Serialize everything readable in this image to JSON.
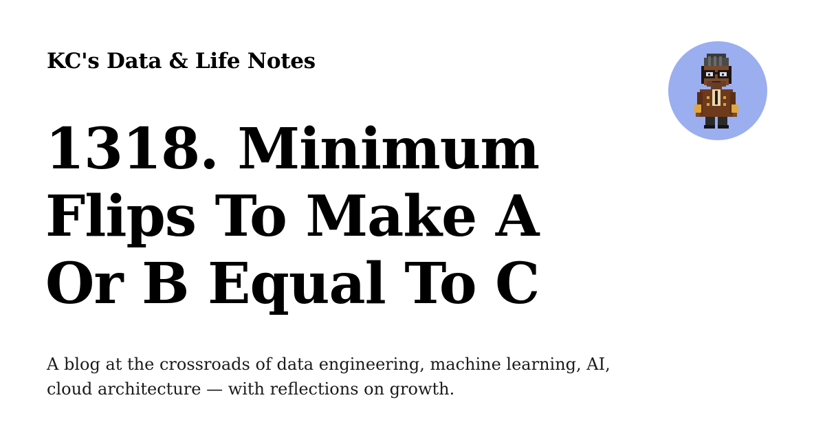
{
  "site": {
    "name": "KC's Data & Life Notes"
  },
  "post": {
    "title": "1318. Minimum Flips To Make A Or B Equal To C"
  },
  "blog": {
    "description": "A blog at the crossroads of data engineering, machine learning, AI, cloud architecture — with reflections on growth."
  },
  "avatar": {
    "icon": "pixel-art-character-avatar",
    "background_color": "#9aaef0"
  }
}
